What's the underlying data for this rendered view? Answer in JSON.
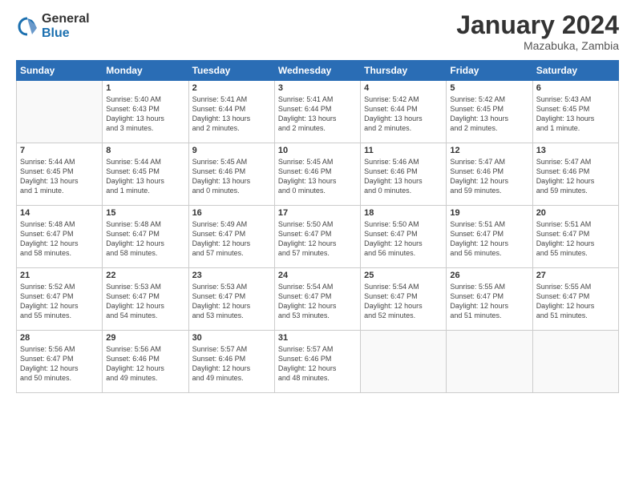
{
  "logo": {
    "general": "General",
    "blue": "Blue"
  },
  "title": "January 2024",
  "subtitle": "Mazabuka, Zambia",
  "days_header": [
    "Sunday",
    "Monday",
    "Tuesday",
    "Wednesday",
    "Thursday",
    "Friday",
    "Saturday"
  ],
  "weeks": [
    [
      {
        "day": "",
        "info": ""
      },
      {
        "day": "1",
        "info": "Sunrise: 5:40 AM\nSunset: 6:43 PM\nDaylight: 13 hours\nand 3 minutes."
      },
      {
        "day": "2",
        "info": "Sunrise: 5:41 AM\nSunset: 6:44 PM\nDaylight: 13 hours\nand 2 minutes."
      },
      {
        "day": "3",
        "info": "Sunrise: 5:41 AM\nSunset: 6:44 PM\nDaylight: 13 hours\nand 2 minutes."
      },
      {
        "day": "4",
        "info": "Sunrise: 5:42 AM\nSunset: 6:44 PM\nDaylight: 13 hours\nand 2 minutes."
      },
      {
        "day": "5",
        "info": "Sunrise: 5:42 AM\nSunset: 6:45 PM\nDaylight: 13 hours\nand 2 minutes."
      },
      {
        "day": "6",
        "info": "Sunrise: 5:43 AM\nSunset: 6:45 PM\nDaylight: 13 hours\nand 1 minute."
      }
    ],
    [
      {
        "day": "7",
        "info": "Sunrise: 5:44 AM\nSunset: 6:45 PM\nDaylight: 13 hours\nand 1 minute."
      },
      {
        "day": "8",
        "info": "Sunrise: 5:44 AM\nSunset: 6:45 PM\nDaylight: 13 hours\nand 1 minute."
      },
      {
        "day": "9",
        "info": "Sunrise: 5:45 AM\nSunset: 6:46 PM\nDaylight: 13 hours\nand 0 minutes."
      },
      {
        "day": "10",
        "info": "Sunrise: 5:45 AM\nSunset: 6:46 PM\nDaylight: 13 hours\nand 0 minutes."
      },
      {
        "day": "11",
        "info": "Sunrise: 5:46 AM\nSunset: 6:46 PM\nDaylight: 13 hours\nand 0 minutes."
      },
      {
        "day": "12",
        "info": "Sunrise: 5:47 AM\nSunset: 6:46 PM\nDaylight: 12 hours\nand 59 minutes."
      },
      {
        "day": "13",
        "info": "Sunrise: 5:47 AM\nSunset: 6:46 PM\nDaylight: 12 hours\nand 59 minutes."
      }
    ],
    [
      {
        "day": "14",
        "info": "Sunrise: 5:48 AM\nSunset: 6:47 PM\nDaylight: 12 hours\nand 58 minutes."
      },
      {
        "day": "15",
        "info": "Sunrise: 5:48 AM\nSunset: 6:47 PM\nDaylight: 12 hours\nand 58 minutes."
      },
      {
        "day": "16",
        "info": "Sunrise: 5:49 AM\nSunset: 6:47 PM\nDaylight: 12 hours\nand 57 minutes."
      },
      {
        "day": "17",
        "info": "Sunrise: 5:50 AM\nSunset: 6:47 PM\nDaylight: 12 hours\nand 57 minutes."
      },
      {
        "day": "18",
        "info": "Sunrise: 5:50 AM\nSunset: 6:47 PM\nDaylight: 12 hours\nand 56 minutes."
      },
      {
        "day": "19",
        "info": "Sunrise: 5:51 AM\nSunset: 6:47 PM\nDaylight: 12 hours\nand 56 minutes."
      },
      {
        "day": "20",
        "info": "Sunrise: 5:51 AM\nSunset: 6:47 PM\nDaylight: 12 hours\nand 55 minutes."
      }
    ],
    [
      {
        "day": "21",
        "info": "Sunrise: 5:52 AM\nSunset: 6:47 PM\nDaylight: 12 hours\nand 55 minutes."
      },
      {
        "day": "22",
        "info": "Sunrise: 5:53 AM\nSunset: 6:47 PM\nDaylight: 12 hours\nand 54 minutes."
      },
      {
        "day": "23",
        "info": "Sunrise: 5:53 AM\nSunset: 6:47 PM\nDaylight: 12 hours\nand 53 minutes."
      },
      {
        "day": "24",
        "info": "Sunrise: 5:54 AM\nSunset: 6:47 PM\nDaylight: 12 hours\nand 53 minutes."
      },
      {
        "day": "25",
        "info": "Sunrise: 5:54 AM\nSunset: 6:47 PM\nDaylight: 12 hours\nand 52 minutes."
      },
      {
        "day": "26",
        "info": "Sunrise: 5:55 AM\nSunset: 6:47 PM\nDaylight: 12 hours\nand 51 minutes."
      },
      {
        "day": "27",
        "info": "Sunrise: 5:55 AM\nSunset: 6:47 PM\nDaylight: 12 hours\nand 51 minutes."
      }
    ],
    [
      {
        "day": "28",
        "info": "Sunrise: 5:56 AM\nSunset: 6:47 PM\nDaylight: 12 hours\nand 50 minutes."
      },
      {
        "day": "29",
        "info": "Sunrise: 5:56 AM\nSunset: 6:46 PM\nDaylight: 12 hours\nand 49 minutes."
      },
      {
        "day": "30",
        "info": "Sunrise: 5:57 AM\nSunset: 6:46 PM\nDaylight: 12 hours\nand 49 minutes."
      },
      {
        "day": "31",
        "info": "Sunrise: 5:57 AM\nSunset: 6:46 PM\nDaylight: 12 hours\nand 48 minutes."
      },
      {
        "day": "",
        "info": ""
      },
      {
        "day": "",
        "info": ""
      },
      {
        "day": "",
        "info": ""
      }
    ]
  ]
}
